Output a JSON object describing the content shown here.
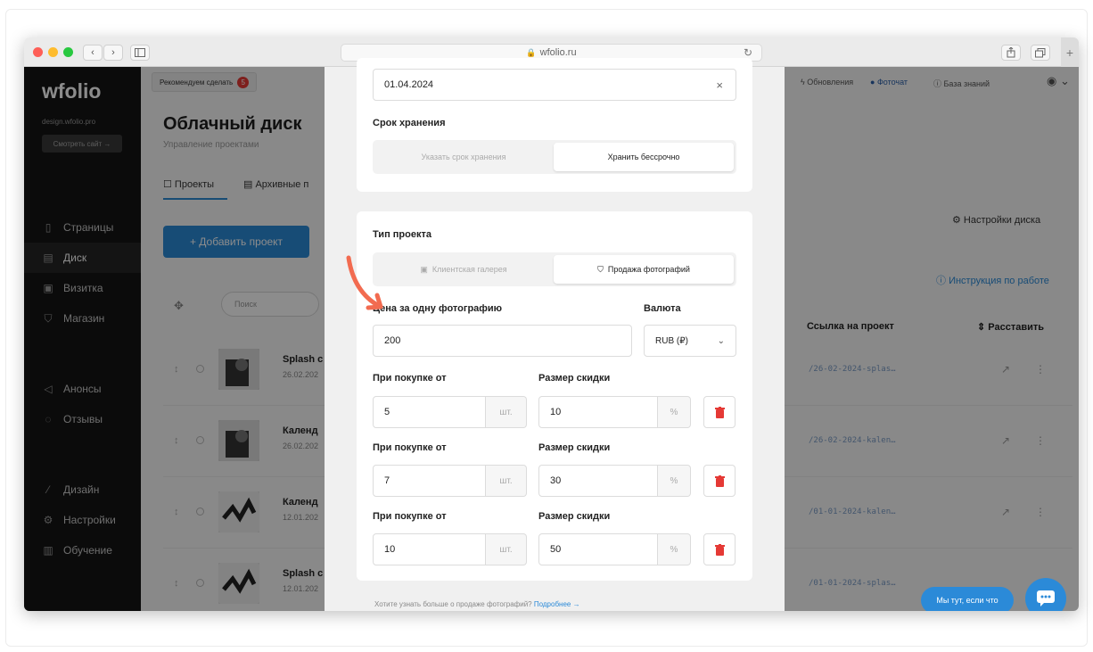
{
  "browser": {
    "url": "wfolio.ru",
    "nav_back": "‹",
    "nav_forward": "›",
    "reload": "↻",
    "new_tab": "+",
    "traffic": {
      "close": "#fe5f57",
      "minimize": "#febc2e",
      "maximize": "#28c840"
    }
  },
  "sidebar": {
    "logo": "wfolio",
    "site": "design.wfolio.pro",
    "view_site": "Смотреть сайт →",
    "items": [
      {
        "label": "Страницы",
        "icon": "page-icon"
      },
      {
        "label": "Диск",
        "icon": "disk-icon"
      },
      {
        "label": "Визитка",
        "icon": "card-icon"
      },
      {
        "label": "Магазин",
        "icon": "cart-icon"
      },
      {
        "label": "Анонсы",
        "icon": "announce-icon"
      },
      {
        "label": "Отзывы",
        "icon": "reviews-icon"
      },
      {
        "label": "Дизайн",
        "icon": "brush-icon"
      },
      {
        "label": "Настройки",
        "icon": "gear-icon"
      },
      {
        "label": "Обучение",
        "icon": "book-icon"
      }
    ]
  },
  "main": {
    "recommend": "Рекомендуем сделать",
    "recommend_count": "5",
    "top_links": {
      "updates": "Обновления",
      "photochat": "Фоточат",
      "knowledge": "База знаний"
    },
    "title": "Облачный диск",
    "subtitle": "Управление проектами",
    "tabs": [
      "Проекты",
      "Архивные п"
    ],
    "disk_settings": "Настройки диска",
    "add_project": "+ Добавить проект",
    "instructions": "Инструкция по работе",
    "search_placeholder": "Поиск",
    "col_link": "Ссылка на проект",
    "col_arrange": "Расставить",
    "rows": [
      {
        "name": "Splash c",
        "date": "26.02.202",
        "link": "/26-02-2024-splas…"
      },
      {
        "name": "Календ",
        "date": "26.02.202",
        "link": "/26-02-2024-kalen…"
      },
      {
        "name": "Календ",
        "date": "12.01.202",
        "link": "/01-01-2024-kalen…"
      },
      {
        "name": "Splash c",
        "date": "12.01.202",
        "link": "/01-01-2024-splas…"
      }
    ]
  },
  "modal": {
    "date_value": "01.04.2024",
    "clear": "×",
    "storage_label": "Срок хранения",
    "storage_options": [
      "Указать срок хранения",
      "Хранить бессрочно"
    ],
    "type_label": "Тип проекта",
    "type_options": [
      "Клиентская галерея",
      "Продажа фотографий"
    ],
    "price_label": "Цена за одну фотографию",
    "price_value": "200",
    "currency_label": "Валюта",
    "currency_value": "RUB (₽)",
    "discounts": [
      {
        "from_label": "При покупке от",
        "size_label": "Размер скидки",
        "qty": "5",
        "unit": "шт.",
        "percent": "10",
        "pct_sign": "%"
      },
      {
        "from_label": "При покупке от",
        "size_label": "Размер скидки",
        "qty": "7",
        "unit": "шт.",
        "percent": "30",
        "pct_sign": "%"
      },
      {
        "from_label": "При покупке от",
        "size_label": "Размер скидки",
        "qty": "10",
        "unit": "шт.",
        "percent": "50",
        "pct_sign": "%"
      }
    ],
    "footer_text": "Хотите узнать больше о продаже фотографий?",
    "footer_link": "Подробнее →"
  },
  "chat": {
    "label": "Мы тут, если что"
  },
  "colors": {
    "accent": "#2b8ad8",
    "danger": "#e53935",
    "arrow": "#f26b50"
  }
}
